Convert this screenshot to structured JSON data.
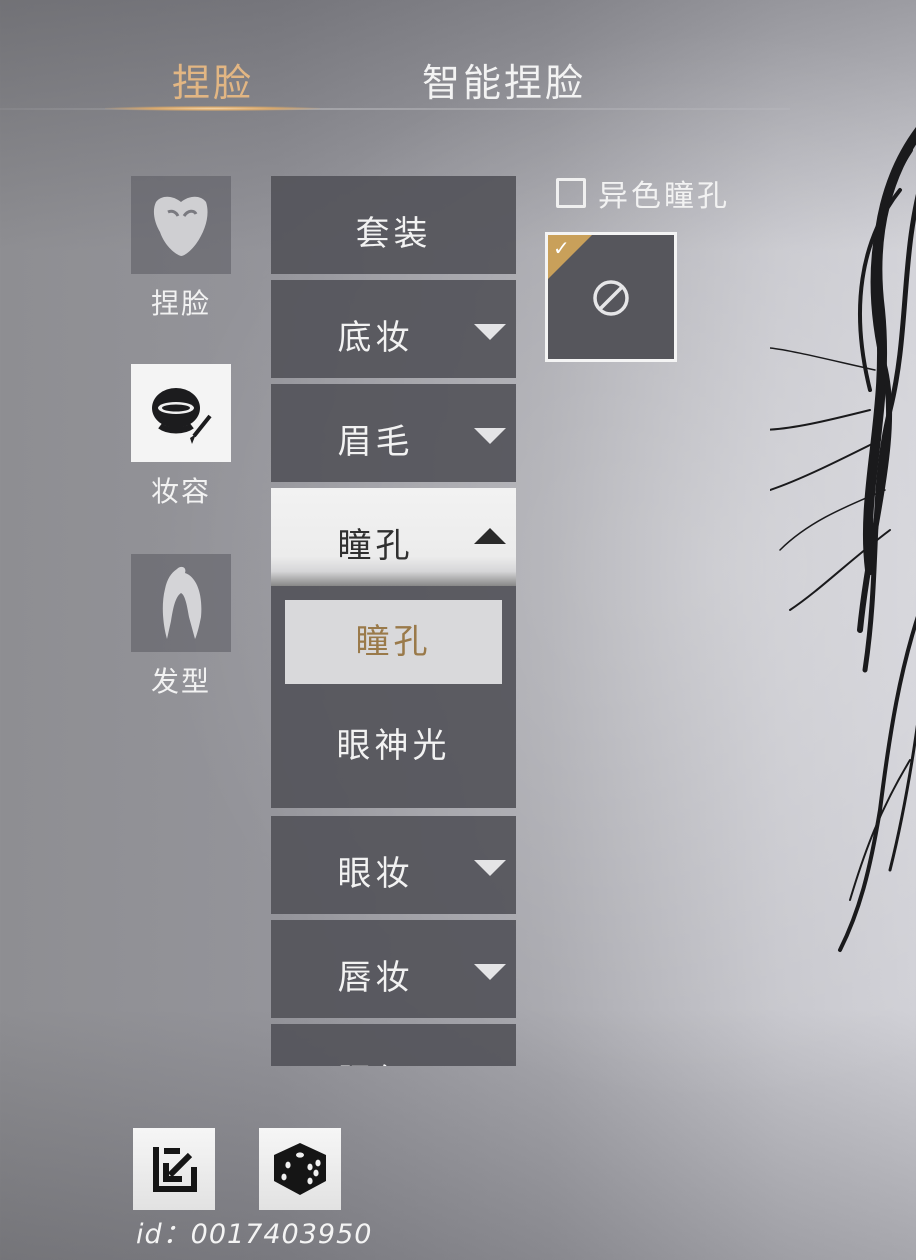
{
  "tabs": {
    "face": "捏脸",
    "smart_face": "智能捏脸"
  },
  "categories": [
    {
      "label": "捏脸",
      "icon": "face-mask-icon"
    },
    {
      "label": "妆容",
      "icon": "makeup-bowl-brush-icon"
    },
    {
      "label": "发型",
      "icon": "hair-icon"
    }
  ],
  "menu": {
    "items": [
      "套装",
      "底妆",
      "眉毛",
      "瞳孔",
      "眼妆",
      "唇妆",
      "腮红"
    ],
    "submenu": [
      "瞳孔",
      "眼神光"
    ]
  },
  "options": {
    "heterochromia_label": "异色瞳孔",
    "swatch_icon": "none-icon",
    "selected_icon": "checkmark-icon"
  },
  "bottom": {
    "import_icon": "import-icon",
    "random_icon": "dice-icon",
    "id_label": "id：0017403950"
  },
  "colors": {
    "accent": "#e2b683",
    "selected_text": "#9a7a4a"
  }
}
